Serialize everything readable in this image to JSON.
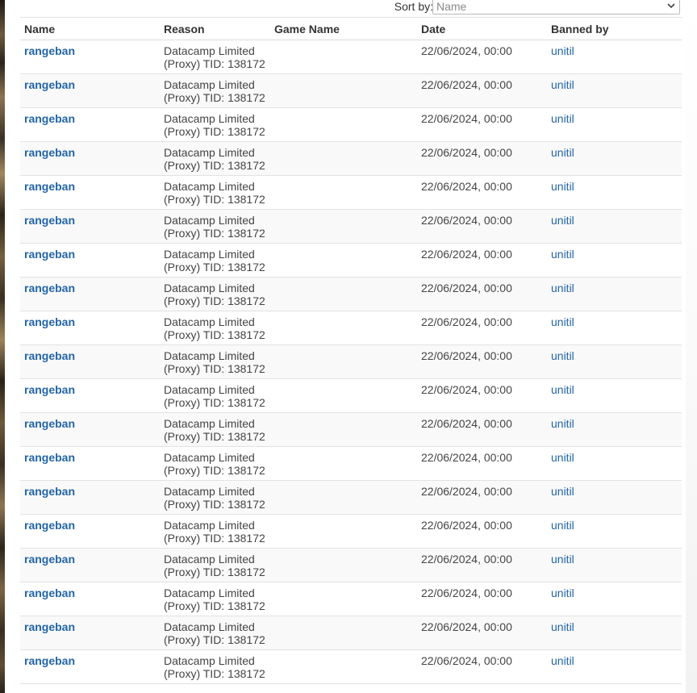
{
  "colors": {
    "link": "#2265a8",
    "text": "#333333",
    "row_alt": "#f9f9f9",
    "border": "#e2e2e2"
  },
  "sort": {
    "label": "Sort by:",
    "selected": "Name",
    "icon": "chevron-down-icon"
  },
  "table": {
    "headers": {
      "name": "Name",
      "reason": "Reason",
      "game": "Game Name",
      "date": "Date",
      "banned_by": "Banned by"
    },
    "rows": [
      {
        "name": "rangeban",
        "reason_line1": "Datacamp Limited",
        "reason_line2": "(Proxy) TID: 138172",
        "game": "",
        "date": "22/06/2024, 00:00",
        "banned_by": "unitil"
      },
      {
        "name": "rangeban",
        "reason_line1": "Datacamp Limited",
        "reason_line2": "(Proxy) TID: 138172",
        "game": "",
        "date": "22/06/2024, 00:00",
        "banned_by": "unitil"
      },
      {
        "name": "rangeban",
        "reason_line1": "Datacamp Limited",
        "reason_line2": "(Proxy) TID: 138172",
        "game": "",
        "date": "22/06/2024, 00:00",
        "banned_by": "unitil"
      },
      {
        "name": "rangeban",
        "reason_line1": "Datacamp Limited",
        "reason_line2": "(Proxy) TID: 138172",
        "game": "",
        "date": "22/06/2024, 00:00",
        "banned_by": "unitil"
      },
      {
        "name": "rangeban",
        "reason_line1": "Datacamp Limited",
        "reason_line2": "(Proxy) TID: 138172",
        "game": "",
        "date": "22/06/2024, 00:00",
        "banned_by": "unitil"
      },
      {
        "name": "rangeban",
        "reason_line1": "Datacamp Limited",
        "reason_line2": "(Proxy) TID: 138172",
        "game": "",
        "date": "22/06/2024, 00:00",
        "banned_by": "unitil"
      },
      {
        "name": "rangeban",
        "reason_line1": "Datacamp Limited",
        "reason_line2": "(Proxy) TID: 138172",
        "game": "",
        "date": "22/06/2024, 00:00",
        "banned_by": "unitil"
      },
      {
        "name": "rangeban",
        "reason_line1": "Datacamp Limited",
        "reason_line2": "(Proxy) TID: 138172",
        "game": "",
        "date": "22/06/2024, 00:00",
        "banned_by": "unitil"
      },
      {
        "name": "rangeban",
        "reason_line1": "Datacamp Limited",
        "reason_line2": "(Proxy) TID: 138172",
        "game": "",
        "date": "22/06/2024, 00:00",
        "banned_by": "unitil"
      },
      {
        "name": "rangeban",
        "reason_line1": "Datacamp Limited",
        "reason_line2": "(Proxy) TID: 138172",
        "game": "",
        "date": "22/06/2024, 00:00",
        "banned_by": "unitil"
      },
      {
        "name": "rangeban",
        "reason_line1": "Datacamp Limited",
        "reason_line2": "(Proxy) TID: 138172",
        "game": "",
        "date": "22/06/2024, 00:00",
        "banned_by": "unitil"
      },
      {
        "name": "rangeban",
        "reason_line1": "Datacamp Limited",
        "reason_line2": "(Proxy) TID: 138172",
        "game": "",
        "date": "22/06/2024, 00:00",
        "banned_by": "unitil"
      },
      {
        "name": "rangeban",
        "reason_line1": "Datacamp Limited",
        "reason_line2": "(Proxy) TID: 138172",
        "game": "",
        "date": "22/06/2024, 00:00",
        "banned_by": "unitil"
      },
      {
        "name": "rangeban",
        "reason_line1": "Datacamp Limited",
        "reason_line2": "(Proxy) TID: 138172",
        "game": "",
        "date": "22/06/2024, 00:00",
        "banned_by": "unitil"
      },
      {
        "name": "rangeban",
        "reason_line1": "Datacamp Limited",
        "reason_line2": "(Proxy) TID: 138172",
        "game": "",
        "date": "22/06/2024, 00:00",
        "banned_by": "unitil"
      },
      {
        "name": "rangeban",
        "reason_line1": "Datacamp Limited",
        "reason_line2": "(Proxy) TID: 138172",
        "game": "",
        "date": "22/06/2024, 00:00",
        "banned_by": "unitil"
      },
      {
        "name": "rangeban",
        "reason_line1": "Datacamp Limited",
        "reason_line2": "(Proxy) TID: 138172",
        "game": "",
        "date": "22/06/2024, 00:00",
        "banned_by": "unitil"
      },
      {
        "name": "rangeban",
        "reason_line1": "Datacamp Limited",
        "reason_line2": "(Proxy) TID: 138172",
        "game": "",
        "date": "22/06/2024, 00:00",
        "banned_by": "unitil"
      },
      {
        "name": "rangeban",
        "reason_line1": "Datacamp Limited",
        "reason_line2": "(Proxy) TID: 138172",
        "game": "",
        "date": "22/06/2024, 00:00",
        "banned_by": "unitil"
      }
    ]
  }
}
